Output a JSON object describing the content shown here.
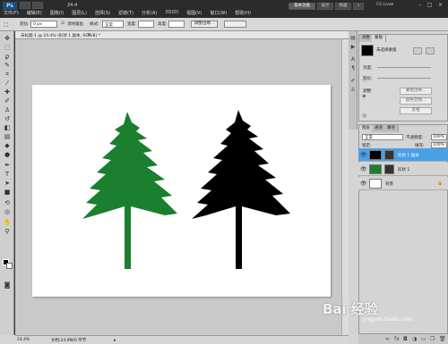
{
  "app": {
    "logo": "Ps",
    "zoom_top": "24.4",
    "menu": [
      "文件(F)",
      "编辑(E)",
      "图像(I)",
      "图层(L)",
      "选择(S)",
      "滤镜(T)",
      "分析(A)",
      "3D(D)",
      "视图(V)",
      "窗口(W)",
      "帮助(H)"
    ],
    "workspaces": [
      "基本功能",
      "设计",
      "绘画",
      "»"
    ],
    "cs_live": "CS Live▾"
  },
  "options": {
    "feather_label": "羽化:",
    "feather_value": "0 px",
    "antialias_label": "消除锯齿",
    "style_label": "样式:",
    "style_value": "正常",
    "width_label": "宽度:",
    "height_label": "高度:",
    "refine_label": "调整边缘..."
  },
  "document": {
    "tab_title": "未标题-1 @ 24.4% (形状 1 副本, RGB/8) *",
    "close": "×",
    "status_zoom": "24.4%",
    "status_doc": "文档:24.9M/0 字节"
  },
  "mask_panel": {
    "tabs": [
      "调整",
      "蒙版"
    ],
    "title": "未选择蒙版",
    "density_label": "浓度:",
    "feather_label": "羽化:",
    "refine_label": "调整:",
    "buttons": [
      "蒙版边缘...",
      "颜色范围...",
      "反相"
    ]
  },
  "layers_panel": {
    "tabs": [
      "图层",
      "通道",
      "路径"
    ],
    "blend_mode": "正常",
    "opacity_label": "不透明度:",
    "opacity_value": "100%",
    "lock_label": "锁定:",
    "fill_label": "填充:",
    "fill_value": "100%",
    "layers": [
      {
        "name": "形状 1 副本",
        "selected": true,
        "thumb_color": "#000000"
      },
      {
        "name": "形状 1",
        "selected": false,
        "thumb_color": "#1a7f2e"
      },
      {
        "name": "背景",
        "selected": false,
        "thumb_color": "#ffffff"
      }
    ],
    "bottom_icons": [
      "link-icon",
      "fx-icon",
      "mask-icon",
      "adjustment-icon",
      "folder-icon",
      "new-layer-icon",
      "trash-icon"
    ]
  },
  "canvas": {
    "tree_left_color": "#1a7f2e",
    "tree_right_color": "#000000"
  },
  "watermark": {
    "brand": "Bai 经验",
    "url": "jingyan.baidu.com"
  }
}
